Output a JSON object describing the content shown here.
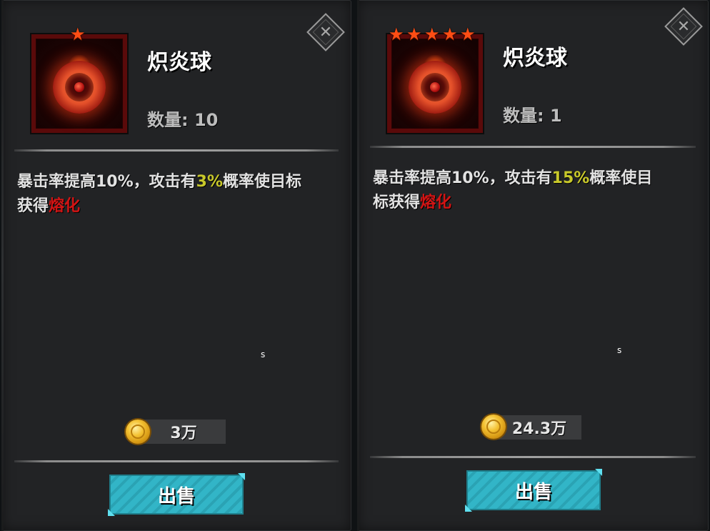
{
  "panels": [
    {
      "stars": 1,
      "item_name": "炽炎球",
      "quantity": "数量: 10",
      "desc_part1": "暴击率提高10%，攻击有",
      "desc_chance": "3%",
      "desc_part2": "概率使目标",
      "desc_part3": "获得",
      "desc_effect": "熔化",
      "stray_char": "s",
      "price": "3万",
      "sell_label": "出售",
      "close_label": "✕"
    },
    {
      "stars": 5,
      "item_name": "炽炎球",
      "quantity": "数量: 1",
      "desc_part1": "暴击率提高10%，攻击有",
      "desc_chance": "15%",
      "desc_part2": "概率使目",
      "desc_part3": "标获得",
      "desc_effect": "熔化",
      "stray_char": "s",
      "price": "24.3万",
      "sell_label": "出售",
      "close_label": "✕"
    }
  ],
  "icons": {
    "star": "★",
    "item": "fire-orb-icon",
    "currency": "gold-coin-icon",
    "close": "close-icon"
  },
  "colors": {
    "highlight_chance": "#c8c82a",
    "highlight_effect": "#d21414",
    "star": "#ff4d14",
    "sell_button": "#32b5c7"
  }
}
